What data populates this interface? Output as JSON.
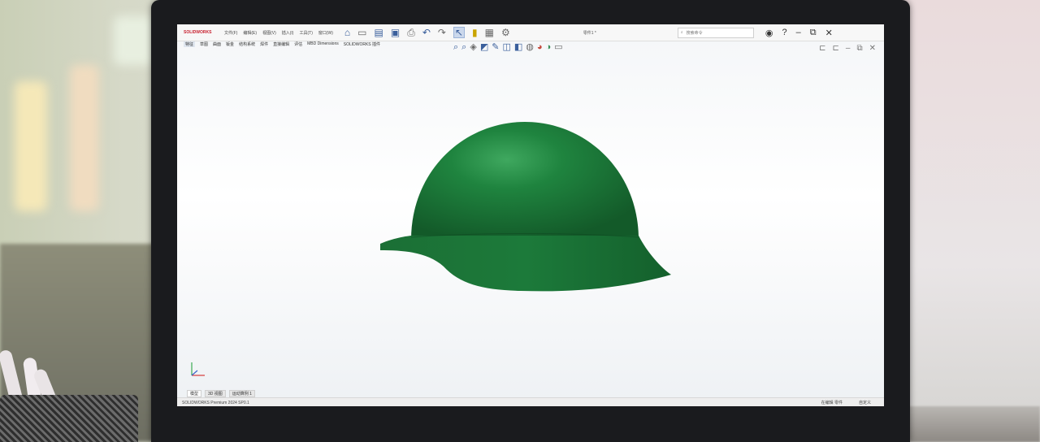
{
  "app": {
    "logo_text": "SOLIDWORKS",
    "menu": [
      "文件(F)",
      "编辑(E)",
      "视图(V)",
      "插入(I)",
      "工具(T)",
      "窗口(W)"
    ],
    "document_title": "零件1 *",
    "search_placeholder": "搜索命令",
    "window_buttons": {
      "minimize": "–",
      "restore": "⧉",
      "close": "✕"
    }
  },
  "command_tabs": [
    "特征",
    "草图",
    "曲面",
    "钣金",
    "结构系统",
    "焊件",
    "直接编辑",
    "评估",
    "MBD Dimensions",
    "SOLIDWORKS 插件"
  ],
  "bottom_tabs": [
    "模型",
    "3D 视图",
    "运动算例 1"
  ],
  "status": {
    "product": "SOLIDWORKS Premium 2024 SP0.1",
    "editing": "在编辑 零件",
    "units": "自定义"
  },
  "colors": {
    "helmet_green": "#1e7a3a",
    "accent_blue": "#3a5f9c"
  }
}
